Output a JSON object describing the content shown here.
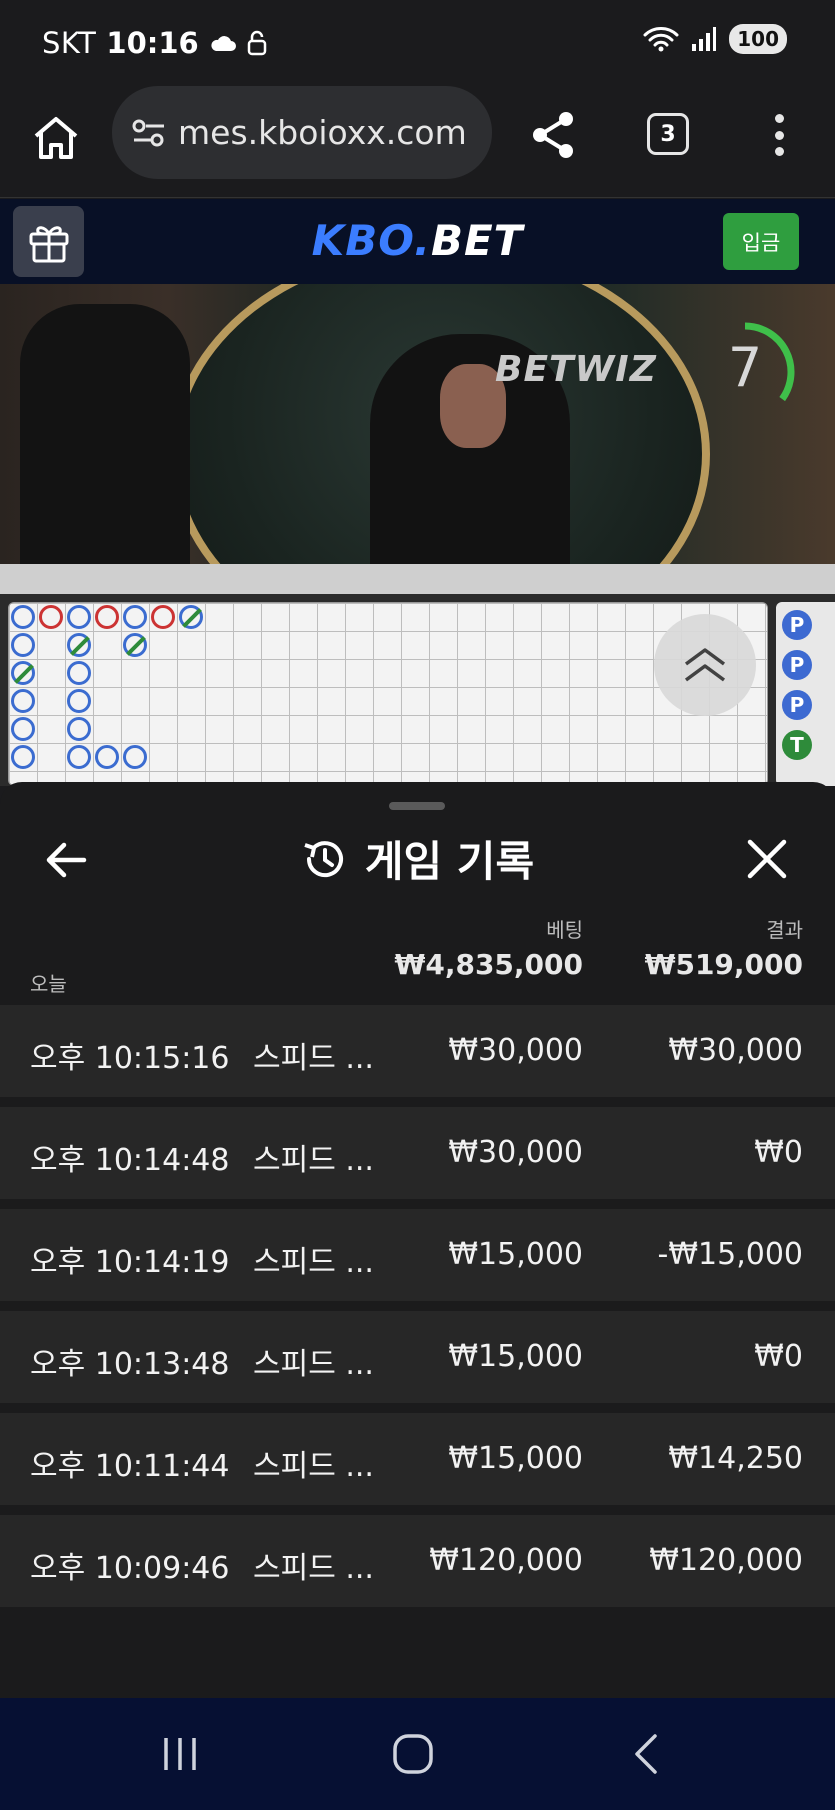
{
  "status": {
    "carrier": "SKT",
    "time": "10:16",
    "battery": "100"
  },
  "browser": {
    "url": "mes.kboioxx.com",
    "tab_count": "3"
  },
  "site": {
    "logo_kbo": "KBO.",
    "logo_bet": "BET",
    "deposit_label": "입금"
  },
  "video": {
    "brand": "BETWIZ",
    "countdown": "7",
    "countdown_progress": 0.35
  },
  "roadmap": {
    "side_badges": [
      "P",
      "P",
      "P",
      "T"
    ]
  },
  "panel": {
    "title": "게임 기록",
    "summary": {
      "today_label": "오늘",
      "bet_header": "베팅",
      "result_header": "결과",
      "bet_total": "₩4,835,000",
      "result_total": "₩519,000"
    },
    "records": [
      {
        "time": "오후 10:15:16",
        "game": "스피드 ...",
        "bet": "₩30,000",
        "result": "₩30,000"
      },
      {
        "time": "오후 10:14:48",
        "game": "스피드 ...",
        "bet": "₩30,000",
        "result": "₩0"
      },
      {
        "time": "오후 10:14:19",
        "game": "스피드 ...",
        "bet": "₩15,000",
        "result": "-₩15,000"
      },
      {
        "time": "오후 10:13:48",
        "game": "스피드 ...",
        "bet": "₩15,000",
        "result": "₩0"
      },
      {
        "time": "오후 10:11:44",
        "game": "스피드 ...",
        "bet": "₩15,000",
        "result": "₩14,250"
      },
      {
        "time": "오후 10:09:46",
        "game": "스피드 ...",
        "bet": "₩120,000",
        "result": "₩120,000"
      }
    ]
  },
  "colors": {
    "accent_blue": "#3b7dff",
    "deposit_green": "#2f9e3f",
    "panel_bg": "#1b1b1c",
    "row_bg": "#272727",
    "nav_bg": "#061033"
  },
  "icons": [
    "cloud-icon",
    "lock-icon",
    "wifi-icon",
    "signal-icon",
    "home-icon",
    "site-settings-icon",
    "share-icon",
    "more-icon",
    "gift-icon",
    "chevron-up-double-icon",
    "back-arrow-icon",
    "history-icon",
    "close-icon",
    "recents-icon",
    "home-nav-icon",
    "back-nav-icon"
  ]
}
